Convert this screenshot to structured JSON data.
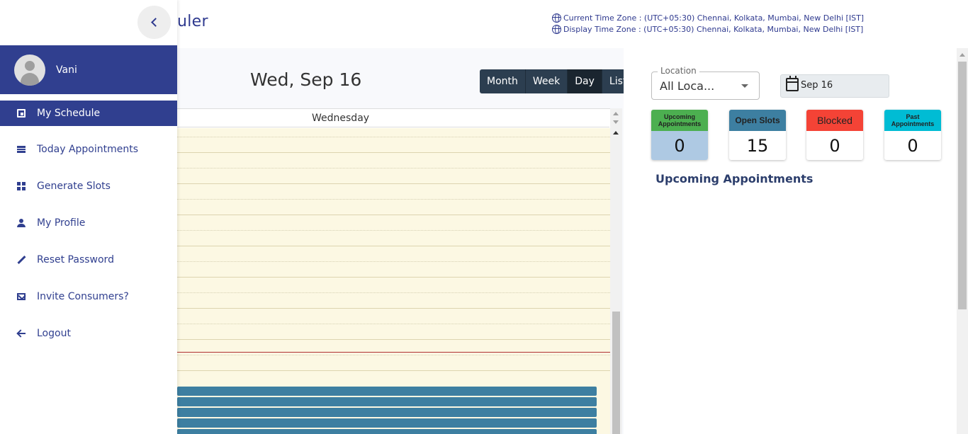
{
  "header": {
    "app_title_fragment": "uler",
    "current_tz": "Current Time Zone : (UTC+05:30) Chennai, Kolkata, Mumbai, New Delhi [IST]",
    "display_tz": "Display Time Zone : (UTC+05:30) Chennai, Kolkata, Mumbai, New Delhi [IST]"
  },
  "sidebar": {
    "user_name": "Vani",
    "items": [
      {
        "label": "My Schedule",
        "icon": "calendar-icon",
        "active": true
      },
      {
        "label": "Today Appointments",
        "icon": "list-icon"
      },
      {
        "label": "Generate Slots",
        "icon": "dashboard-icon"
      },
      {
        "label": "My Profile",
        "icon": "person-icon"
      },
      {
        "label": "Reset Password",
        "icon": "pencil-icon"
      },
      {
        "label": "Invite Consumers?",
        "icon": "mail-icon"
      },
      {
        "label": "Logout",
        "icon": "arrow-back-icon"
      }
    ]
  },
  "calendar": {
    "date_title": "Wed, Sep 16",
    "views": [
      "Month",
      "Week",
      "Day",
      "List"
    ],
    "active_view": "Day",
    "day_header": "Wednesday"
  },
  "filters": {
    "location_label": "Location",
    "location_value": "All Loca...",
    "date_value": "Sep 16"
  },
  "stats": [
    {
      "label": "Upcoming Appointments",
      "value": "0",
      "color": "#4caf50",
      "body": "#aec9e3"
    },
    {
      "label": "Open Slots",
      "value": "15",
      "color": "#3d7fa1",
      "body": "#ffffff"
    },
    {
      "label": "Blocked",
      "value": "0",
      "color": "#f44336",
      "body": "#ffffff"
    },
    {
      "label": "Past Appointments",
      "value": "0",
      "color": "#00bcd4",
      "body": "#ffffff"
    }
  ],
  "upcoming_title": "Upcoming Appointments"
}
